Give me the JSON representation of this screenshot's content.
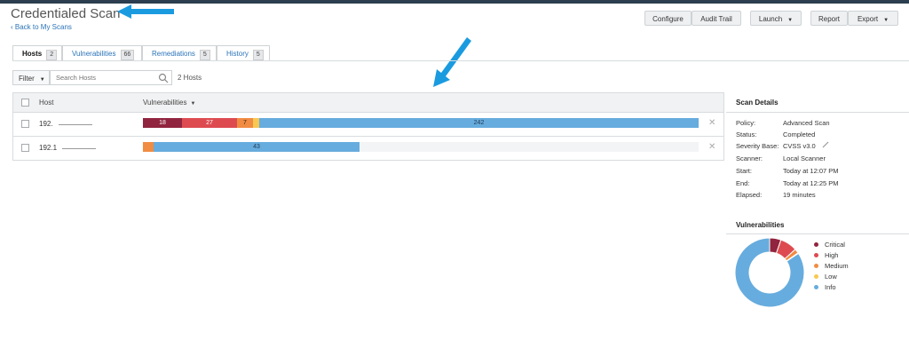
{
  "header": {
    "title": "Credentialed Scan",
    "back_link": "‹ Back to My Scans",
    "buttons": {
      "configure": "Configure",
      "audit_trail": "Audit Trail",
      "launch": "Launch",
      "report": "Report",
      "export": "Export"
    }
  },
  "tabs": [
    {
      "label": "Hosts",
      "count": "2",
      "active": true
    },
    {
      "label": "Vulnerabilities",
      "count": "66",
      "active": false
    },
    {
      "label": "Remediations",
      "count": "5",
      "active": false
    },
    {
      "label": "History",
      "count": "5",
      "active": false
    }
  ],
  "toolbar": {
    "filter_label": "Filter",
    "search_placeholder": "Search Hosts",
    "hosts_count": "2 Hosts"
  },
  "table": {
    "columns": {
      "host": "Host",
      "vulnerabilities": "Vulnerabilities"
    },
    "rows": [
      {
        "host": "192.",
        "counts": {
          "critical": "18",
          "high": "27",
          "medium": "7",
          "low": "",
          "info": "242"
        }
      },
      {
        "host": "192.1",
        "counts": {
          "critical": "",
          "high": "",
          "medium": "",
          "low": "",
          "info": "43"
        }
      }
    ]
  },
  "scan_details": {
    "title": "Scan Details",
    "items": [
      {
        "key": "Policy:",
        "value": "Advanced Scan"
      },
      {
        "key": "Status:",
        "value": "Completed"
      },
      {
        "key": "Severity Base:",
        "value": "CVSS v3.0"
      },
      {
        "key": "Scanner:",
        "value": "Local Scanner"
      },
      {
        "key": "Start:",
        "value": "Today at 12:07 PM"
      },
      {
        "key": "End:",
        "value": "Today at 12:25 PM"
      },
      {
        "key": "Elapsed:",
        "value": "19 minutes"
      }
    ]
  },
  "vuln_chart": {
    "title": "Vulnerabilities",
    "legend": [
      "Critical",
      "High",
      "Medium",
      "Low",
      "Info"
    ],
    "colors": {
      "critical": "#91243e",
      "high": "#dd4b50",
      "medium": "#f18c43",
      "low": "#f8c851",
      "info": "#67acde",
      "track": "#f3f4f5"
    }
  },
  "chart_data": {
    "type": "pie",
    "labels": [
      "Critical",
      "High",
      "Medium",
      "Low",
      "Info"
    ],
    "values": [
      18,
      27,
      7,
      1,
      285
    ]
  },
  "icons": {
    "search": "search-icon",
    "pencil": "pencil-icon",
    "remove": "close-icon",
    "sort": "sort-caret-icon"
  }
}
